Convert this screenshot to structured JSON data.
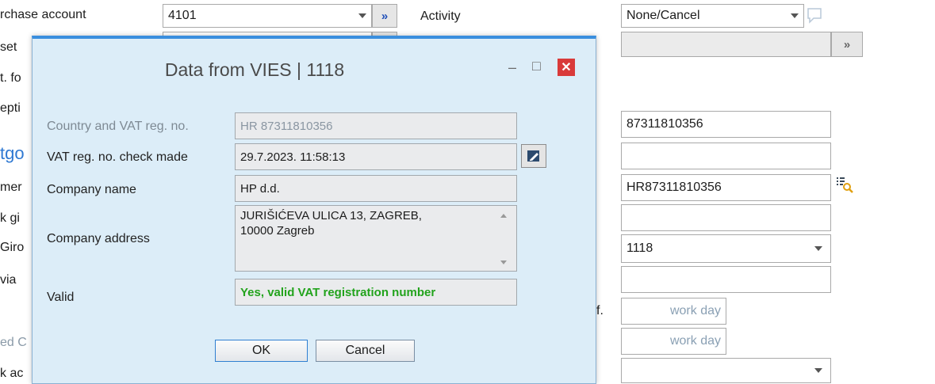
{
  "background": {
    "labels": {
      "purchase_account": "rchase account",
      "asset": "set",
      "accounts_fo": "t. fo",
      "reception": "epti",
      "outgoing": "tgo",
      "number": "mer",
      "bank_giro": "k gi",
      "e_giro": "Giro",
      "via": "via",
      "f_label": "f.",
      "created": "ed C",
      "bank_account": "k ac",
      "activity": "Activity"
    },
    "fields": {
      "purchase_account_value": "4101",
      "activity_value": "None/Cancel",
      "vat_number": "87311810356",
      "vat_id": "HR87311810356",
      "code": "1118",
      "work_day_1": "work day",
      "work_day_2": "work day"
    },
    "icons": {
      "double_chevron": "double-chevron-right-icon",
      "comment": "comment-bubble-icon",
      "search_list": "search-list-icon"
    }
  },
  "dialog": {
    "title": "Data from VIES | 1118",
    "minimize_glyph": "–",
    "maximize_glyph": "□",
    "close_glyph": "✕",
    "rows": [
      {
        "label": "Country and VAT reg. no.",
        "value": "HR 87311810356"
      },
      {
        "label": "VAT reg. no. check made",
        "value": "29.7.2023. 11:58:13"
      },
      {
        "label": "Company name",
        "value": "HP d.d."
      },
      {
        "label": "Company address",
        "value_line1": "JURIŠIĆEVA ULICA 13, ZAGREB,",
        "value_line2": "10000 Zagreb"
      },
      {
        "label": "Valid",
        "value": "Yes, valid VAT registration number"
      }
    ],
    "ok_label": "OK",
    "cancel_label": "Cancel",
    "colors": {
      "accent": "#3a8ede",
      "close": "#d93a3a",
      "valid_text": "#22a31c",
      "background": "#dcedf8"
    }
  }
}
